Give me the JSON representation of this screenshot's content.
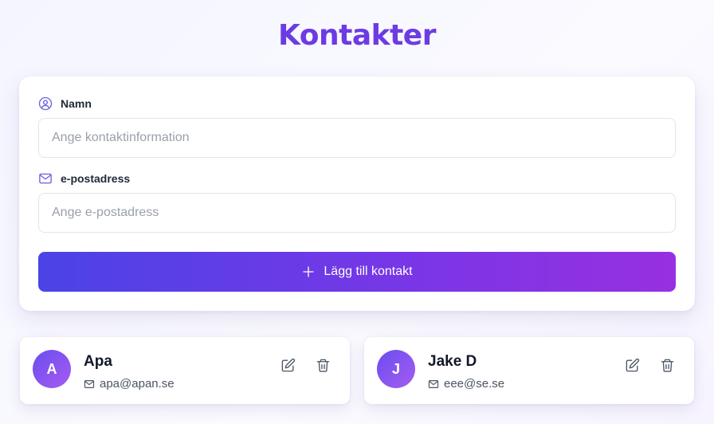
{
  "header": {
    "title": "Kontakter"
  },
  "form": {
    "name_label": "Namn",
    "name_icon": "user-circle-icon",
    "name_value": "",
    "name_placeholder": "Ange kontaktinformation",
    "email_label": "e-postadress",
    "email_icon": "mail-icon",
    "email_value": "",
    "email_placeholder": "Ange e-postadress",
    "add_button_label": "Lägg till kontakt",
    "add_button_icon": "plus-icon"
  },
  "contacts": [
    {
      "initial": "A",
      "name": "Apa",
      "email": "apa@apan.se",
      "edit_icon": "edit-icon",
      "delete_icon": "trash-icon"
    },
    {
      "initial": "J",
      "name": "Jake D",
      "email": "eee@se.se",
      "edit_icon": "edit-icon",
      "delete_icon": "trash-icon"
    }
  ],
  "colors": {
    "accent": "#6d3be2",
    "button_gradient_start": "#4a43e6",
    "button_gradient_end": "#9730e0",
    "avatar_gradient_start": "#6a4df0",
    "avatar_gradient_end": "#a65cf0"
  }
}
